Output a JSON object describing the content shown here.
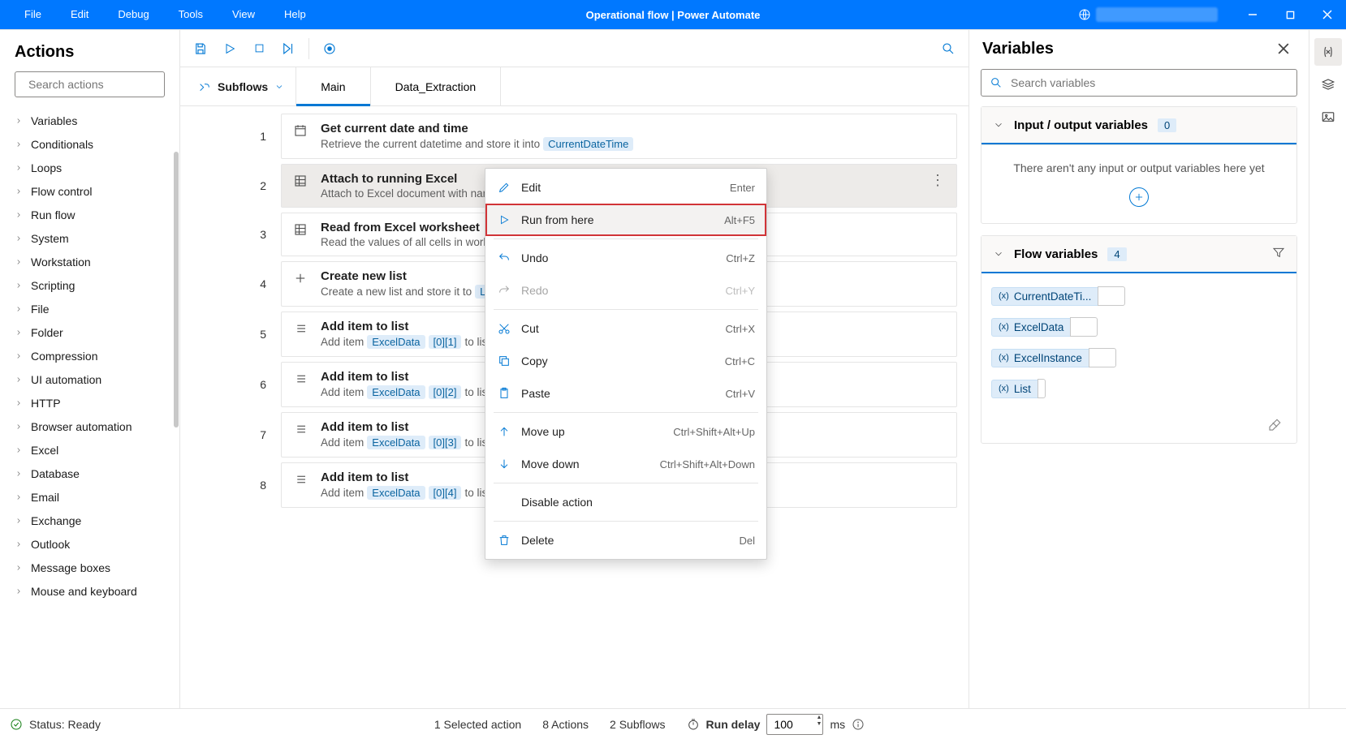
{
  "window": {
    "title": "Operational flow | Power Automate",
    "menu": [
      "File",
      "Edit",
      "Debug",
      "Tools",
      "View",
      "Help"
    ]
  },
  "actions_panel": {
    "heading": "Actions",
    "search_placeholder": "Search actions",
    "categories": [
      "Variables",
      "Conditionals",
      "Loops",
      "Flow control",
      "Run flow",
      "System",
      "Workstation",
      "Scripting",
      "File",
      "Folder",
      "Compression",
      "UI automation",
      "HTTP",
      "Browser automation",
      "Excel",
      "Database",
      "Email",
      "Exchange",
      "Outlook",
      "Message boxes",
      "Mouse and keyboard"
    ]
  },
  "designer": {
    "subflows_label": "Subflows",
    "tabs": [
      "Main",
      "Data_Extraction"
    ],
    "active_tab": 0,
    "steps": [
      {
        "num": "1",
        "title": "Get current date and time",
        "desc_pre": "Retrieve the current datetime and store it into",
        "tokens": [
          "CurrentDateTime"
        ],
        "icon": "calendar"
      },
      {
        "num": "2",
        "title": "Attach to running Excel",
        "desc_pre": "Attach to Excel document with nam",
        "tokens": [],
        "icon": "excel",
        "selected": true,
        "show_more": true
      },
      {
        "num": "3",
        "title": "Read from Excel worksheet",
        "desc_pre": "Read the values of all cells in works",
        "tokens": [],
        "icon": "excel"
      },
      {
        "num": "4",
        "title": "Create new list",
        "desc_pre": "Create a new list and store it to",
        "tokens": [
          "Li"
        ],
        "icon": "plus"
      },
      {
        "num": "5",
        "title": "Add item to list",
        "desc_pre": "Add item",
        "tokens": [
          "ExcelData",
          "[0][1]"
        ],
        "desc_post": "to list",
        "icon": "list"
      },
      {
        "num": "6",
        "title": "Add item to list",
        "desc_pre": "Add item",
        "tokens": [
          "ExcelData",
          "[0][2]"
        ],
        "desc_post": "to list",
        "icon": "list"
      },
      {
        "num": "7",
        "title": "Add item to list",
        "desc_pre": "Add item",
        "tokens": [
          "ExcelData",
          "[0][3]"
        ],
        "desc_post": "to list",
        "icon": "list"
      },
      {
        "num": "8",
        "title": "Add item to list",
        "desc_pre": "Add item",
        "tokens": [
          "ExcelData",
          "[0][4]"
        ],
        "desc_post": "to list",
        "icon": "list"
      }
    ],
    "context_menu": [
      {
        "label": "Edit",
        "shortcut": "Enter",
        "icon": "pencil"
      },
      {
        "label": "Run from here",
        "shortcut": "Alt+F5",
        "icon": "play",
        "highlight": true
      },
      {
        "sep": true
      },
      {
        "label": "Undo",
        "shortcut": "Ctrl+Z",
        "icon": "undo"
      },
      {
        "label": "Redo",
        "shortcut": "Ctrl+Y",
        "icon": "redo",
        "disabled": true
      },
      {
        "sep": true
      },
      {
        "label": "Cut",
        "shortcut": "Ctrl+X",
        "icon": "cut"
      },
      {
        "label": "Copy",
        "shortcut": "Ctrl+C",
        "icon": "copy"
      },
      {
        "label": "Paste",
        "shortcut": "Ctrl+V",
        "icon": "paste"
      },
      {
        "sep": true
      },
      {
        "label": "Move up",
        "shortcut": "Ctrl+Shift+Alt+Up",
        "icon": "up"
      },
      {
        "label": "Move down",
        "shortcut": "Ctrl+Shift+Alt+Down",
        "icon": "down"
      },
      {
        "sep": true
      },
      {
        "label": "Disable action",
        "shortcut": "",
        "icon": ""
      },
      {
        "sep": true
      },
      {
        "label": "Delete",
        "shortcut": "Del",
        "icon": "trash"
      }
    ]
  },
  "variables": {
    "heading": "Variables",
    "search_placeholder": "Search variables",
    "io_section": {
      "title": "Input / output variables",
      "count": "0",
      "empty": "There aren't any input or output variables here yet"
    },
    "flow_section": {
      "title": "Flow variables",
      "count": "4",
      "vars": [
        "CurrentDateTi...",
        "ExcelData",
        "ExcelInstance",
        "List"
      ]
    }
  },
  "statusbar": {
    "status": "Status: Ready",
    "selected": "1 Selected action",
    "actions": "8 Actions",
    "subflows": "2 Subflows",
    "run_delay_label": "Run delay",
    "run_delay_value": "100",
    "run_delay_unit": "ms"
  }
}
